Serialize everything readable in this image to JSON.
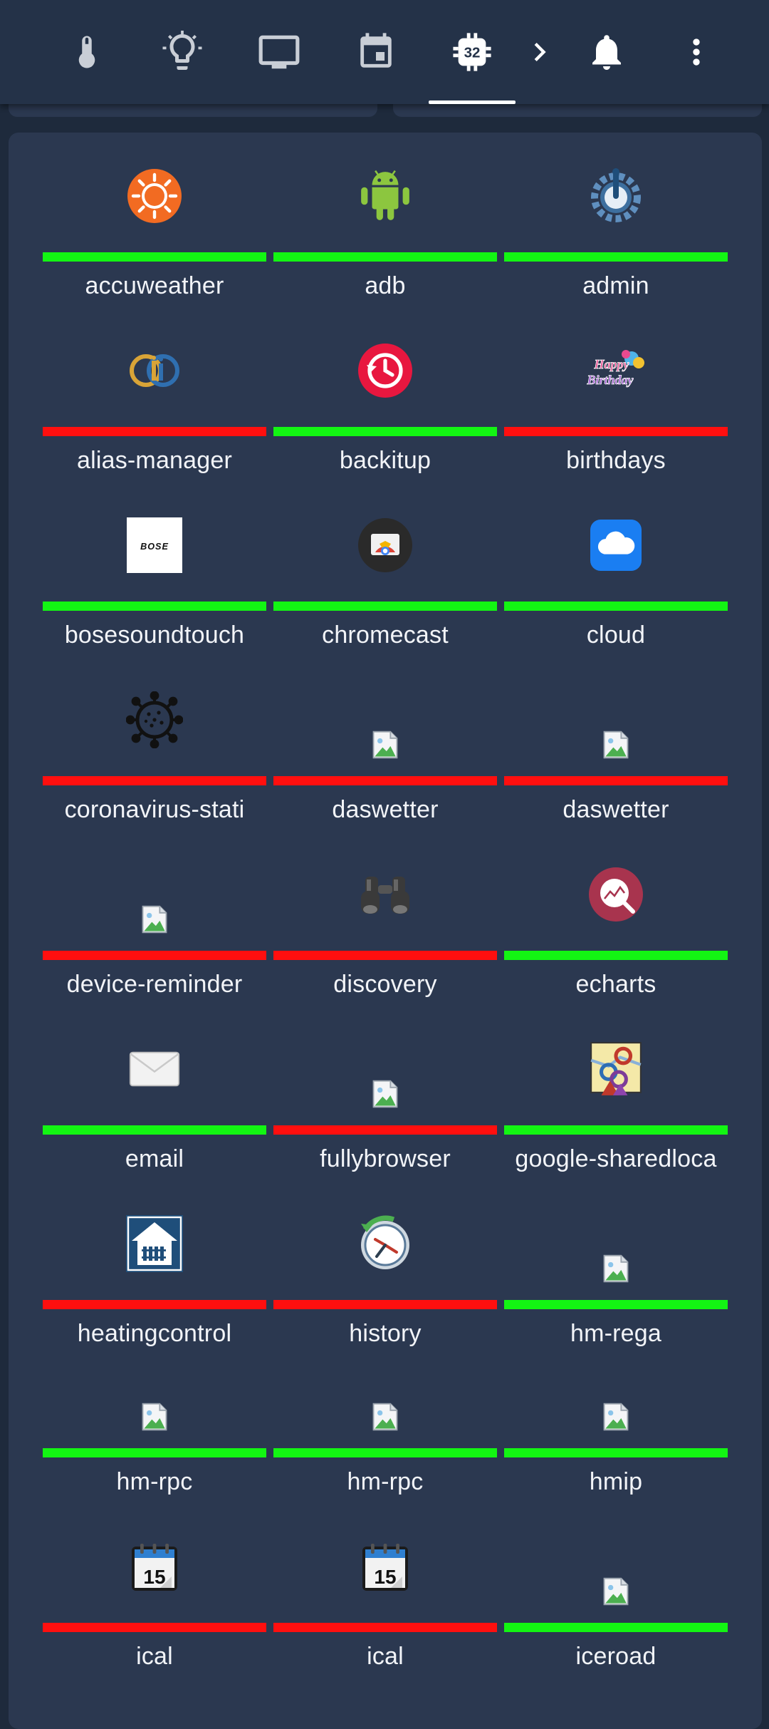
{
  "toolbar": {
    "tabs": [
      {
        "icon": "thermometer-icon"
      },
      {
        "icon": "lightbulb-icon"
      },
      {
        "icon": "monitor-icon"
      },
      {
        "icon": "calendar-icon"
      },
      {
        "icon": "chip-icon",
        "badge": "32",
        "active": true
      },
      {
        "icon": "chevron-right-icon"
      },
      {
        "icon": "bell-icon"
      },
      {
        "icon": "more-vertical-icon"
      }
    ]
  },
  "colors": {
    "background": "#1e2a3c",
    "panel": "#2b3850",
    "status_ok": "#13f513",
    "status_error": "#ff0f0f"
  },
  "adapters": [
    {
      "name": "accuweather",
      "status": "ok",
      "icon": "sun-icon"
    },
    {
      "name": "adb",
      "status": "ok",
      "icon": "android-icon"
    },
    {
      "name": "admin",
      "status": "ok",
      "icon": "gear-icon"
    },
    {
      "name": "alias-manager",
      "status": "error",
      "icon": "alias-logo-icon"
    },
    {
      "name": "backitup",
      "status": "ok",
      "icon": "backup-clock-icon"
    },
    {
      "name": "birthdays",
      "status": "error",
      "icon": "happy-birthday-icon"
    },
    {
      "name": "bosesoundtouch",
      "status": "ok",
      "icon": "bose-logo-icon"
    },
    {
      "name": "chromecast",
      "status": "ok",
      "icon": "chromecast-icon"
    },
    {
      "name": "cloud",
      "status": "ok",
      "icon": "cloud-icon"
    },
    {
      "name": "coronavirus-stati",
      "status": "error",
      "icon": "virus-icon"
    },
    {
      "name": "daswetter",
      "status": "error",
      "icon": "broken-image-icon"
    },
    {
      "name": "daswetter",
      "status": "error",
      "icon": "broken-image-icon"
    },
    {
      "name": "device-reminder",
      "status": "error",
      "icon": "broken-image-icon"
    },
    {
      "name": "discovery",
      "status": "error",
      "icon": "binoculars-icon"
    },
    {
      "name": "echarts",
      "status": "ok",
      "icon": "chart-magnifier-icon"
    },
    {
      "name": "email",
      "status": "ok",
      "icon": "envelope-icon"
    },
    {
      "name": "fullybrowser",
      "status": "error",
      "icon": "broken-image-icon"
    },
    {
      "name": "google-sharedloca",
      "status": "ok",
      "icon": "map-pins-icon"
    },
    {
      "name": "heatingcontrol",
      "status": "error",
      "icon": "house-radiator-icon"
    },
    {
      "name": "history",
      "status": "error",
      "icon": "history-clock-icon"
    },
    {
      "name": "hm-rega",
      "status": "ok",
      "icon": "broken-image-icon"
    },
    {
      "name": "hm-rpc",
      "status": "ok",
      "icon": "broken-image-icon"
    },
    {
      "name": "hm-rpc",
      "status": "ok",
      "icon": "broken-image-icon"
    },
    {
      "name": "hmip",
      "status": "ok",
      "icon": "broken-image-icon"
    },
    {
      "name": "ical",
      "status": "error",
      "icon": "calendar-page-icon"
    },
    {
      "name": "ical",
      "status": "error",
      "icon": "calendar-page-icon"
    },
    {
      "name": "iceroad",
      "status": "ok",
      "icon": "broken-image-icon"
    }
  ],
  "calendar_day": "15",
  "bose_text": "BOSE",
  "birthday_text": "Happy Birthday"
}
